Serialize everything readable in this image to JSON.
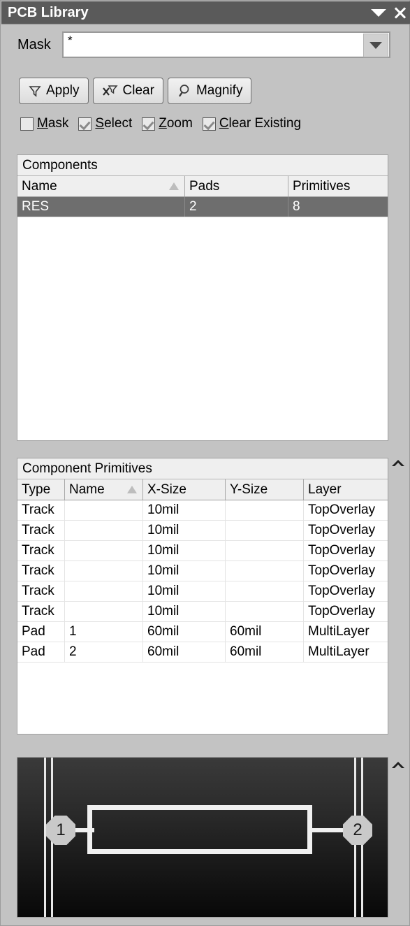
{
  "window": {
    "title": "PCB Library",
    "menu_icon": "triangle-down-icon",
    "close_icon": "close-icon"
  },
  "mask": {
    "label": "Mask",
    "value": "*",
    "placeholder": "",
    "dropdown_icon": "chevron-down-icon"
  },
  "toolbar": {
    "apply_label": "Apply",
    "clear_label": "Clear",
    "magnify_label": "Magnify",
    "apply_icon": "funnel-icon",
    "clear_icon": "funnel-clear-icon",
    "magnify_icon": "magnifier-icon"
  },
  "options": [
    {
      "label": "Mask",
      "mnemonic": "M",
      "checked": false
    },
    {
      "label": "Select",
      "mnemonic": "S",
      "checked": true
    },
    {
      "label": "Zoom",
      "mnemonic": "Z",
      "checked": true
    },
    {
      "label": "Clear Existing",
      "mnemonic": "C",
      "checked": true
    }
  ],
  "components_panel": {
    "caption": "Components",
    "columns": [
      "Name",
      "Pads",
      "Primitives"
    ],
    "sort_column": "Name",
    "sort_direction": "ascending",
    "rows": [
      {
        "name": "RES",
        "pads": "2",
        "primitives": "8",
        "selected": true
      }
    ]
  },
  "primitives_panel": {
    "caption": "Component Primitives",
    "collapse_icon": "chevron-up-icon",
    "columns": [
      "Type",
      "Name",
      "X-Size",
      "Y-Size",
      "Layer"
    ],
    "sort_column": "Name",
    "sort_direction": "ascending",
    "rows": [
      {
        "type": "Track",
        "name": "",
        "x_size": "10mil",
        "y_size": "",
        "layer": "TopOverlay"
      },
      {
        "type": "Track",
        "name": "",
        "x_size": "10mil",
        "y_size": "",
        "layer": "TopOverlay"
      },
      {
        "type": "Track",
        "name": "",
        "x_size": "10mil",
        "y_size": "",
        "layer": "TopOverlay"
      },
      {
        "type": "Track",
        "name": "",
        "x_size": "10mil",
        "y_size": "",
        "layer": "TopOverlay"
      },
      {
        "type": "Track",
        "name": "",
        "x_size": "10mil",
        "y_size": "",
        "layer": "TopOverlay"
      },
      {
        "type": "Track",
        "name": "",
        "x_size": "10mil",
        "y_size": "",
        "layer": "TopOverlay"
      },
      {
        "type": "Pad",
        "name": "1",
        "x_size": "60mil",
        "y_size": "60mil",
        "layer": "MultiLayer"
      },
      {
        "type": "Pad",
        "name": "2",
        "x_size": "60mil",
        "y_size": "60mil",
        "layer": "MultiLayer"
      }
    ]
  },
  "preview_panel": {
    "collapse_icon": "chevron-up-icon",
    "background_color": "#1a1a1a",
    "silk_color": "#f0f0f0",
    "pad_color": "#c9c9c9",
    "pads": [
      {
        "designator": "1"
      },
      {
        "designator": "2"
      }
    ]
  }
}
